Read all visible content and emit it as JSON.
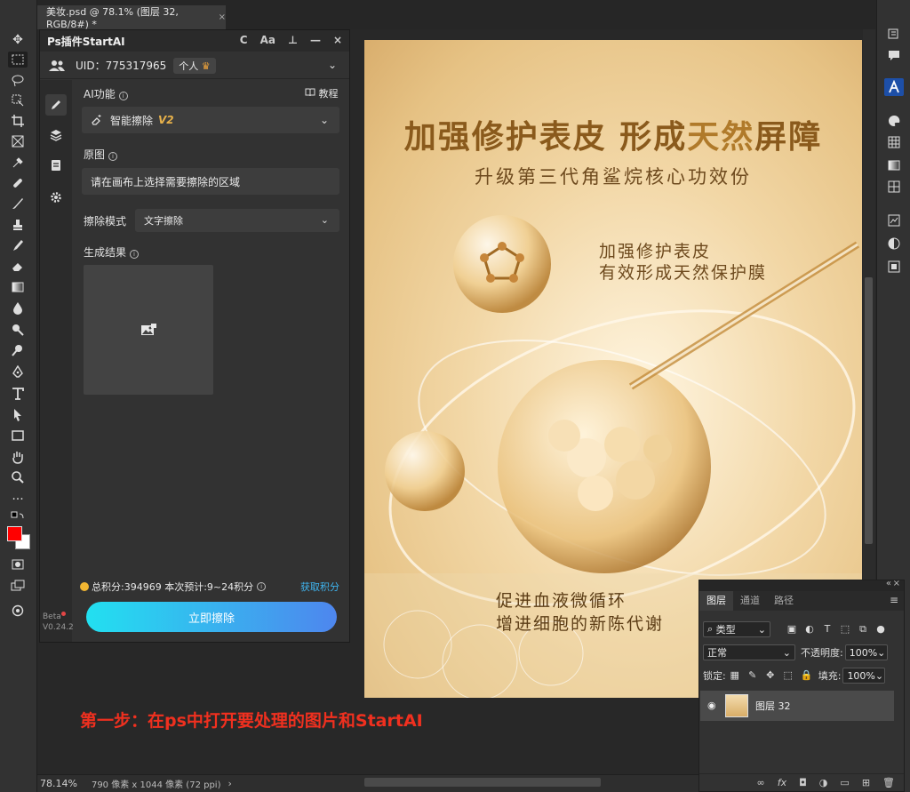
{
  "document": {
    "tab_title": "美妆.psd @ 78.1% (图层 32, RGB/8#) *",
    "close_glyph": "×"
  },
  "plugin": {
    "title": "Ps插件StartAI",
    "header_controls": [
      "C",
      "Aa",
      "⊥",
      "—",
      "×"
    ],
    "uid_label": "UID：775317965",
    "account_tag": "个人",
    "ai_function_label": "AI功能",
    "tutorial_label": "教程",
    "function_value": "智能擦除",
    "function_version": "V2",
    "source_label": "原图",
    "source_prompt": "请在画布上选择需要擦除的区域",
    "mode_label": "擦除模式",
    "mode_value": "文字擦除",
    "result_label": "生成结果",
    "points_text": "总积分:394969  本次预计:9~24积分",
    "get_points": "获取积分",
    "action_button": "立即擦除",
    "beta_label": "Beta",
    "version": "V0.24.2"
  },
  "artwork": {
    "title_a": "加强修护表皮 形成",
    "title_b": "天然",
    "title_c": "屏障",
    "subtitle": "升级第三代角鲨烷核心功效份",
    "text1_line1": "加强修护表皮",
    "text1_line2": "有效形成天然保护膜",
    "text2_line1": "促进血液微循环",
    "text2_line2": "增进细胞的新陈代谢"
  },
  "caption": "第一步：在ps中打开要处理的图片和StartAI",
  "status": {
    "zoom": "78.14%",
    "size": "790 像素 x 1044 像素 (72 ppi)",
    "arrow": "›"
  },
  "layers": {
    "tabs": [
      "图层",
      "通道",
      "路径"
    ],
    "filter_type": "类型",
    "blend_mode": "正常",
    "opacity_label": "不透明度:",
    "opacity_value": "100%",
    "lock_label": "锁定:",
    "fill_label": "填充:",
    "fill_value": "100%",
    "layer_name": "图层 32"
  },
  "colors": {
    "foreground": "#ff0000",
    "background": "#ffffff",
    "action_gradient_start": "#22e0f0",
    "action_gradient_end": "#4e86ee",
    "caption": "#f0301f",
    "points_link": "#3fb5f0"
  }
}
